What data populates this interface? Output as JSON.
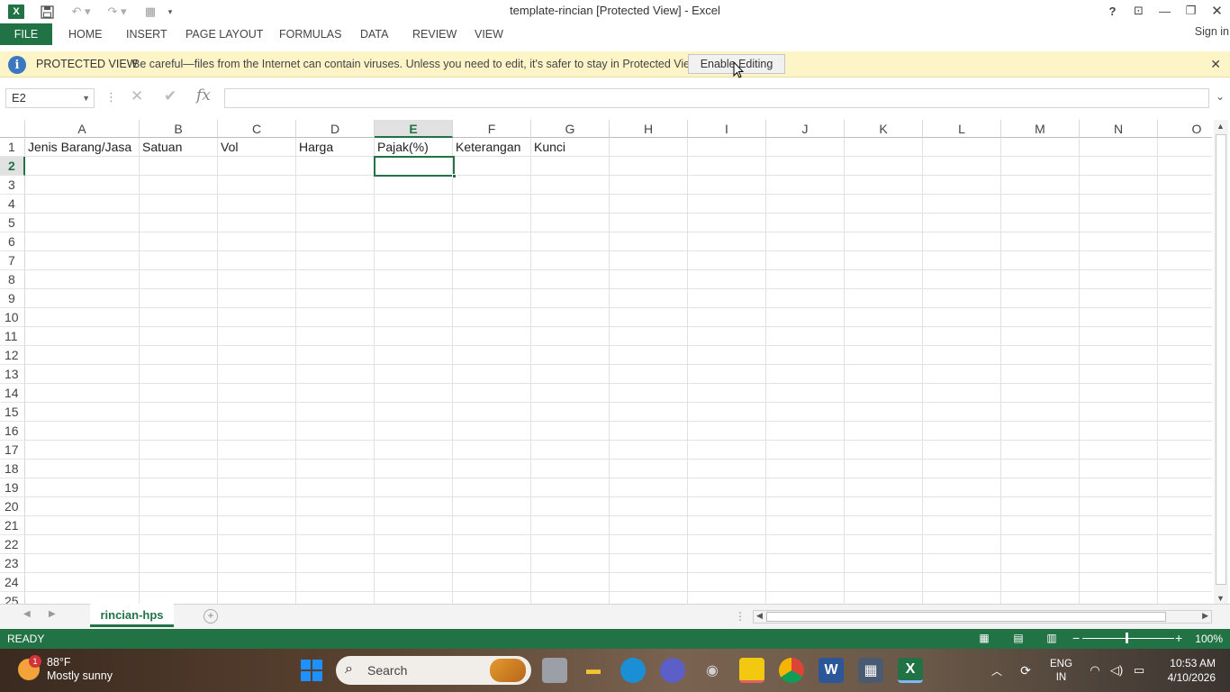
{
  "window": {
    "title": "template-rincian  [Protected View] - Excel",
    "help": "?",
    "restore_ribbon": "⊡",
    "minimize": "—",
    "maximize": "❐",
    "close": "✕"
  },
  "qat": {
    "logo": "X",
    "save_icon": "save-icon",
    "undo_icon": "undo-icon",
    "redo_icon": "redo-icon",
    "customize_icon": "table-icon"
  },
  "ribbon": {
    "tabs": [
      "FILE",
      "HOME",
      "INSERT",
      "PAGE LAYOUT",
      "FORMULAS",
      "DATA",
      "REVIEW",
      "VIEW"
    ],
    "sign_in": "Sign in"
  },
  "protected_view": {
    "title": "PROTECTED VIEW",
    "message": "Be careful—files from the Internet can contain viruses. Unless you need to edit, it's safer to stay in Protected View.",
    "button": "Enable Editing",
    "close": "✕"
  },
  "formula_bar": {
    "name_box": "E2",
    "fx": "fx",
    "value": ""
  },
  "sheet": {
    "columns": [
      "A",
      "B",
      "C",
      "D",
      "E",
      "F",
      "G",
      "H",
      "I",
      "J",
      "K",
      "L",
      "M",
      "N",
      "O"
    ],
    "rows": [
      "1",
      "2",
      "3",
      "4",
      "5",
      "6",
      "7",
      "8",
      "9",
      "10",
      "11",
      "12",
      "13",
      "14",
      "15",
      "16",
      "17",
      "18",
      "19",
      "20",
      "21",
      "22",
      "23",
      "24",
      "25"
    ],
    "selected_column": "E",
    "selected_row": "2",
    "header_row": [
      "Jenis Barang/Jasa",
      "Satuan",
      "Vol",
      "Harga",
      "Pajak(%)",
      "Keterangan",
      "Kunci"
    ]
  },
  "sheet_tabs": {
    "active": "rincian-hps",
    "add": "+"
  },
  "status": {
    "ready": "READY",
    "zoom": "100%"
  },
  "taskbar": {
    "weather_temp": "88°F",
    "weather_desc": "Mostly sunny",
    "weather_badge": "1",
    "search_label": "Search",
    "lang_top": "ENG",
    "lang_bottom": "IN",
    "time": "10:53 AM",
    "date": "4/10/2026"
  }
}
